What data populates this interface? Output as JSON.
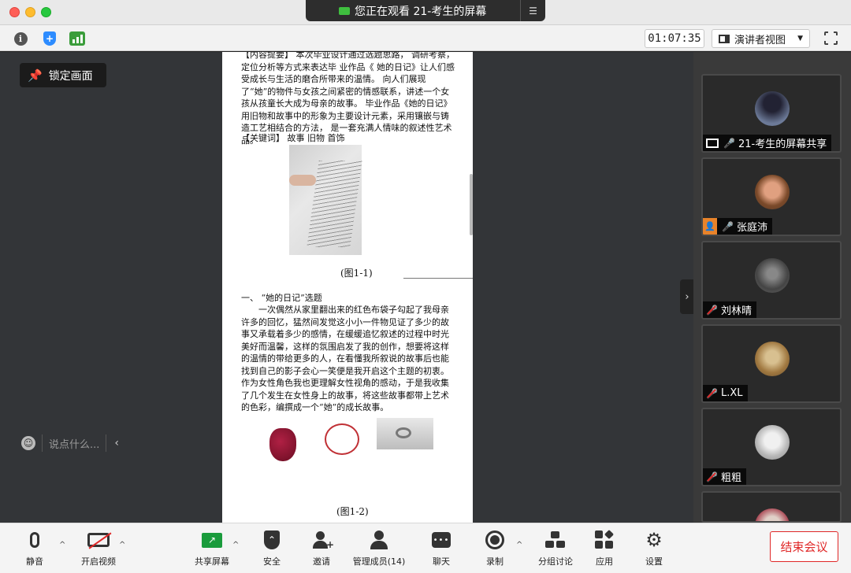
{
  "window": {
    "share_banner": "您正在观看 21-考生的屏幕",
    "timer": "01:07:35",
    "view_mode": "演讲者视图"
  },
  "main": {
    "lock_screen": "锁定画面",
    "chat_placeholder": "说点什么..."
  },
  "document": {
    "abstract": "【内容提要】 本次毕业设计通过选题思路， 调研考察， 定位分析等方式来表达毕 业作品《 她的日记》让人们感受成长与生活的磨合所带来的温情。 向人们展现了“她”的物件与女孩之间紧密的情感联系，讲述一个女孩从孩童长大成为母亲的故事。 毕业作品《她的日记》 用旧物和故事中的形象为主要设计元素，采用镶嵌与铸造工艺相结合的方法， 是一套充满人情味的叙述性艺术品。",
    "keywords": "【关键词】 故事 旧物 首饰",
    "caption1": "(图1-1)",
    "section_title": "一、 “她的日记”选题",
    "body": "一次偶然从家里翻出来的红色布袋子勾起了我母亲许多的回忆，猛然间发觉这小小一件物见证了多少的故事又承载着多少的感情，在缓缓追忆叙述的过程中时光美好而温馨，这样的氛围启发了我的创作，想要将这样的温情的带给更多的人，在看懂我所叙说的故事后也能找到自己的影子会心一笑便是我开启这个主题的初衷。作为女性角色我也更理解女性视角的感动，于是我收集了几个发生在女性身上的故事，将这些故事都带上艺术的色彩，编撰成一个“她”的成长故事。",
    "caption2": "(图1-2)"
  },
  "participants": [
    {
      "name": "21-考生的屏幕共享",
      "type": "screen-share",
      "mic": "on"
    },
    {
      "name": "张庭沛",
      "type": "user",
      "mic": "on"
    },
    {
      "name": "刘林晴",
      "type": "video",
      "mic": "muted"
    },
    {
      "name": "L.XL",
      "type": "video",
      "mic": "muted"
    },
    {
      "name": "粗粗",
      "type": "video",
      "mic": "muted"
    }
  ],
  "bottom_bar": {
    "mute": "静音",
    "start_video": "开启视频",
    "share_screen": "共享屏幕",
    "security": "安全",
    "invite": "邀请",
    "manage_members": "管理成员(14)",
    "chat": "聊天",
    "record": "录制",
    "breakout": "分组讨论",
    "apps": "应用",
    "settings": "设置",
    "end_meeting": "结束会议"
  },
  "colors": {
    "end_red": "#e02828",
    "share_green": "#1a9b3c",
    "security_blue": "#2d8cff",
    "tag_orange": "#e8832a"
  }
}
